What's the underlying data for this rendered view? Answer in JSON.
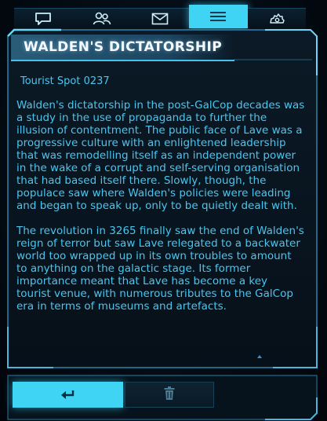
{
  "tabs": [
    {
      "id": "messages",
      "icon": "speech-bubble-icon",
      "active": false
    },
    {
      "id": "contacts",
      "icon": "people-icon",
      "active": false
    },
    {
      "id": "mail",
      "icon": "envelope-icon",
      "active": false
    },
    {
      "id": "list",
      "icon": "list-icon",
      "active": true
    },
    {
      "id": "settings",
      "icon": "gear-icon",
      "active": false
    }
  ],
  "article": {
    "title": "WALDEN'S DICTATORSHIP",
    "subtitle": "Tourist Spot 0237",
    "paragraphs": [
      "Walden's dictatorship in the post-GalCop decades was a study in the use of propaganda to further the illusion of contentment. The public face of Lave was a progressive culture with an enlightened leadership that was remodelling itself as an independent power in the wake of a corrupt and self-serving organisation that had based itself there. Slowly, though, the populace saw where Walden's policies were leading and began to speak up, only to be quietly dealt with.",
      "The revolution in 3265 finally saw the end of Walden's reign of terror but saw Lave relegated to a backwater world too wrapped up in its own troubles to amount to anything on the galactic stage. Its former importance meant that Lave has become a key tourist venue, with numerous tributes to the GalCop era in terms of museums and artefacts."
    ]
  },
  "actions": {
    "back_icon": "return-arrow-icon",
    "delete_icon": "trash-icon"
  },
  "colors": {
    "accent": "#3fd3f4",
    "text": "#49c6ef",
    "title": "#f4faff",
    "background": "#040c14"
  }
}
